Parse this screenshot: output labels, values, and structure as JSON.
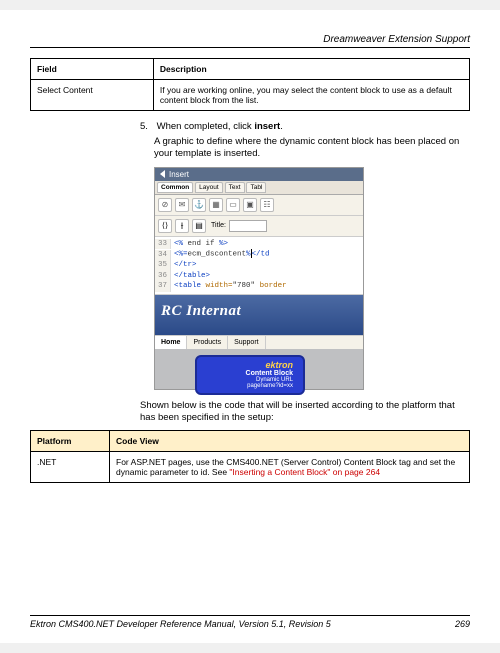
{
  "header": {
    "section_title": "Dreamweaver Extension Support"
  },
  "table_fields": {
    "col1": "Field",
    "col2": "Description",
    "row1_field": "Select Content",
    "row1_desc": "If you are working online, you may select the content block to use as a default content block from the list."
  },
  "step5": {
    "num": "5.",
    "text_prefix": "When completed, click ",
    "text_bold": "insert",
    "text_suffix": "."
  },
  "para_after_step": "A graphic to define where the dynamic content block has been placed on your template is inserted.",
  "screenshot": {
    "panel_title": "Insert",
    "tabs": [
      "Common",
      "Layout",
      "Text",
      "Tabl"
    ],
    "title_label": "Title:",
    "code_lines": [
      {
        "n": "33",
        "html": "<% end if %>"
      },
      {
        "n": "34",
        "html": "<%=ecm_dscontent%|</td"
      },
      {
        "n": "35",
        "html": "</tr>"
      },
      {
        "n": "36",
        "html": "</table>"
      },
      {
        "n": "37",
        "html": "<table width=\"780\" border"
      }
    ],
    "banner": "RC Internat",
    "nav": [
      "Home",
      "Products",
      "Support"
    ],
    "block": {
      "brand": "ektron",
      "title": "Content Block",
      "sub1": "Dynamic URL",
      "sub2": "pagename?id=xx"
    }
  },
  "para_below_shot": "Shown below is the code that will be inserted according to the platform that has been specified in the setup:",
  "table_code": {
    "col1": "Platform",
    "col2": "Code View",
    "row1_plat": ".NET",
    "row1_desc_pre": "For ASP.NET pages, use the CMS400.NET (Server Control) Content Block tag and set the dynamic parameter to id. See ",
    "row1_link": "\"Inserting a Content Block\" on page 264"
  },
  "footer": {
    "left": "Ektron CMS400.NET Developer Reference Manual, Version 5.1, Revision 5",
    "right": "269"
  }
}
